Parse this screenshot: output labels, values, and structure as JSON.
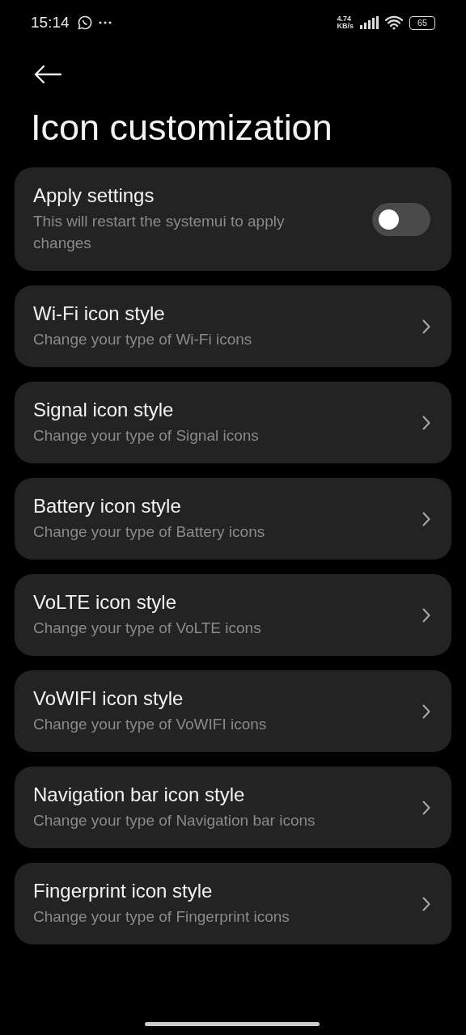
{
  "status_bar": {
    "time": "15:14",
    "speed": "4.74",
    "speed_unit": "KB/s",
    "battery": "65"
  },
  "title": "Icon customization",
  "apply": {
    "title": "Apply settings",
    "subtitle": "This will restart the systemui to apply changes",
    "on": false
  },
  "items": [
    {
      "title": "Wi-Fi icon style",
      "subtitle": "Change your type of Wi-Fi icons"
    },
    {
      "title": "Signal icon style",
      "subtitle": "Change your type of Signal icons"
    },
    {
      "title": "Battery icon style",
      "subtitle": "Change your type of Battery icons"
    },
    {
      "title": "VoLTE icon style",
      "subtitle": "Change your type of VoLTE icons"
    },
    {
      "title": "VoWIFI icon style",
      "subtitle": "Change your type of VoWIFI icons"
    },
    {
      "title": "Navigation bar icon style",
      "subtitle": "Change your type of Navigation bar icons"
    },
    {
      "title": "Fingerprint icon style",
      "subtitle": "Change your type of Fingerprint icons"
    }
  ]
}
